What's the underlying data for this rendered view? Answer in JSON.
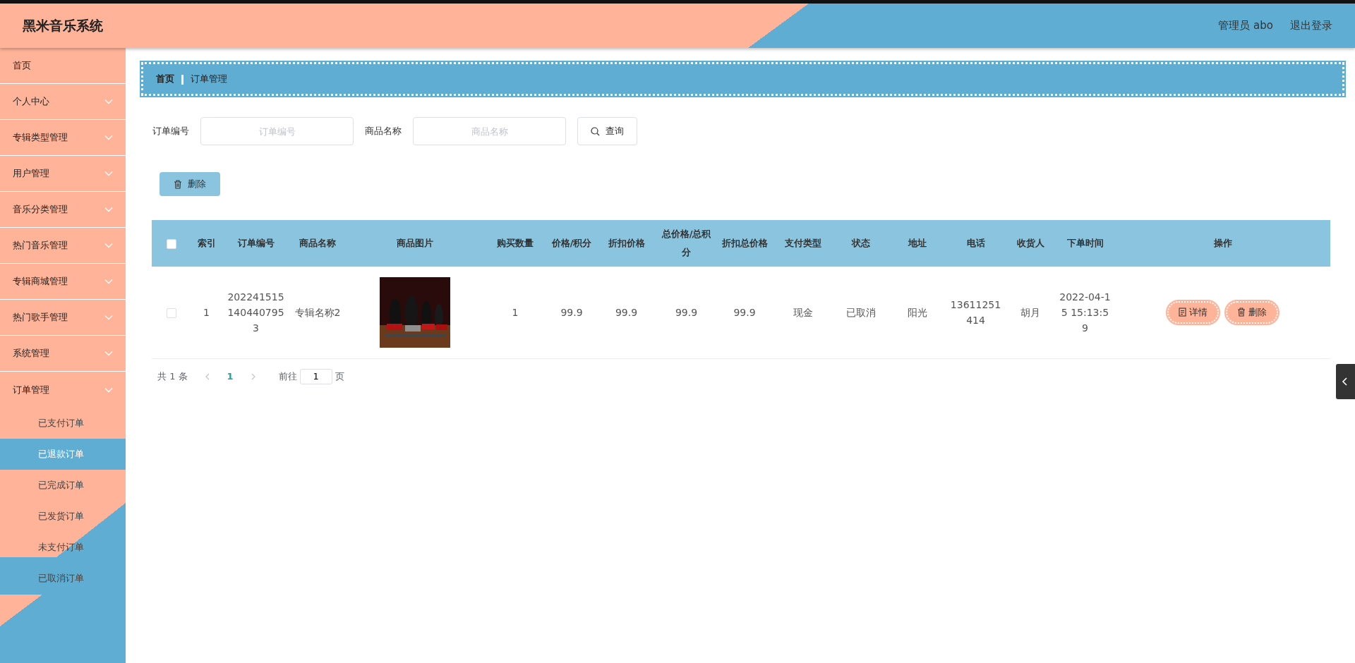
{
  "header": {
    "title": "黑米音乐系统",
    "user": "管理员 abo",
    "logout": "退出登录"
  },
  "sidebar": {
    "items": [
      {
        "label": "首页",
        "kind": "link"
      },
      {
        "label": "个人中心",
        "kind": "menu",
        "expanded": false
      },
      {
        "label": "专辑类型管理",
        "kind": "menu",
        "expanded": false
      },
      {
        "label": "用户管理",
        "kind": "menu",
        "expanded": false
      },
      {
        "label": "音乐分类管理",
        "kind": "menu",
        "expanded": false
      },
      {
        "label": "热门音乐管理",
        "kind": "menu",
        "expanded": false
      },
      {
        "label": "专辑商城管理",
        "kind": "menu",
        "expanded": false
      },
      {
        "label": "热门歌手管理",
        "kind": "menu",
        "expanded": false
      },
      {
        "label": "系统管理",
        "kind": "menu",
        "expanded": false
      },
      {
        "label": "订单管理",
        "kind": "menu",
        "expanded": true,
        "children": [
          {
            "label": "已支付订单",
            "selected": false
          },
          {
            "label": "已退款订单",
            "selected": true
          },
          {
            "label": "已完成订单",
            "selected": false
          },
          {
            "label": "已发货订单",
            "selected": false
          },
          {
            "label": "未支付订单",
            "selected": false
          },
          {
            "label": "已取消订单",
            "selected": false
          }
        ]
      }
    ]
  },
  "breadcrumb": [
    "首页",
    "订单管理"
  ],
  "search": {
    "fields": [
      {
        "label": "订单编号",
        "placeholder": "订单编号"
      },
      {
        "label": "商品名称",
        "placeholder": "商品名称"
      }
    ],
    "button": "查询"
  },
  "toolbar": {
    "delete_button": "删除"
  },
  "table": {
    "select_all_checked": false,
    "columns": [
      "索引",
      "订单编号",
      "商品名称",
      "商品图片",
      "购买数量",
      "价格/积分",
      "折扣价格",
      "总价格/总积分",
      "折扣总价格",
      "支付类型",
      "状态",
      "地址",
      "电话",
      "收货人",
      "下单时间",
      "操作"
    ],
    "rows": [
      {
        "checked": false,
        "cells": [
          "1",
          "2022415151404407953",
          "专辑名称2",
          {
            "kind": "picture"
          },
          "1",
          "99.9",
          "99.9",
          "99.9",
          "99.9",
          "现金",
          "已取消",
          "阳光",
          "13611251414",
          "胡月",
          "2022-04-15 15:13:59"
        ],
        "actions": [
          {
            "label": "详情",
            "kind": "detail"
          },
          {
            "label": "删除",
            "kind": "delete"
          }
        ]
      }
    ]
  },
  "pagination": {
    "total": "共 1 条",
    "pages": [
      {
        "label": "1",
        "selected": true
      }
    ],
    "goto": "前往",
    "goto_value": "1",
    "suffix": "页"
  }
}
